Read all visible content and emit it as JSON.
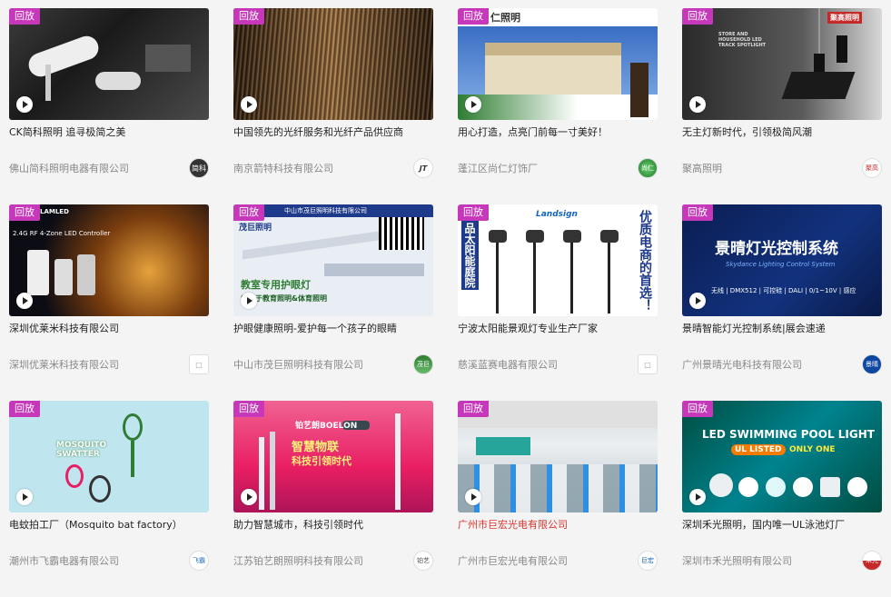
{
  "badge_label": "回放",
  "cards": [
    {
      "title": "CK简科照明 追寻极简之美",
      "company": "佛山简科照明电器有限公司",
      "title_color": "#222222"
    },
    {
      "title": "中国领先的光纤服务和光纤产品供应商",
      "company": "南京箭特科技有限公司",
      "title_color": "#222222"
    },
    {
      "title": "用心打造，点亮门前每一寸美好！",
      "company": "蓬江区尚仁灯饰厂",
      "title_color": "#222222"
    },
    {
      "title": "无主灯新时代，引领极简风潮",
      "company": "聚高照明",
      "title_color": "#222222"
    },
    {
      "title": "深圳优莱米科技有限公司",
      "company": "深圳优莱米科技有限公司",
      "title_color": "#222222"
    },
    {
      "title": "护眼健康照明-爱护每一个孩子的眼睛",
      "company": "中山市茂巨照明科技有限公司",
      "title_color": "#222222"
    },
    {
      "title": "宁波太阳能景观灯专业生产厂家",
      "company": "慈溪蓝赛电器有限公司",
      "title_color": "#222222"
    },
    {
      "title": "景晴智能灯光控制系统|展会速递",
      "company": "广州景晴光电科技有限公司",
      "title_color": "#222222"
    },
    {
      "title": "电蚊拍工厂（Mosquito bat factory）",
      "company": "潮州市飞霸电器有限公司",
      "title_color": "#222222"
    },
    {
      "title": "助力智慧城市，科技引领时代",
      "company": "江苏铂艺朗照明科技有限公司",
      "title_color": "#222222"
    },
    {
      "title": "广州市巨宏光电有限公司",
      "company": "广州市巨宏光电有限公司",
      "title_color": "#d9352b"
    },
    {
      "title": "深圳禾光照明，国内唯一UL泳池灯厂",
      "company": "深圳市禾光照明有限公司",
      "title_color": "#222222"
    }
  ],
  "thumb_text": {
    "c3_brand": "仁照明",
    "c4_top": "聚高照明",
    "c4_sub": "STORE AND HOUSEHOLD LED TRACK SPOTLIGHT",
    "c5_brand": "LAMLED",
    "c5_sub": "2.4G RF 4-Zone LED Controller",
    "c6_header": "中山市茂巨照明科技有限公司",
    "c6_brand": "茂巨照明",
    "c6_line1": "教室专用护眼灯",
    "c6_line2": "专注于教育照明&体育照明",
    "c7_brand": "Landsign",
    "c7_left": "品太阳能庭院",
    "c7_right": "优质电商的首选！",
    "c8_title": "景晴灯光控制系统",
    "c8_sub": "Skydance Lighting Control System",
    "c8_tags": "无线 | DMX512 | 可控硅 | DALI | 0/1~10V | 感应",
    "c9_title": "MOSQUITO SWATTER",
    "c10_brand": "铂艺朗BOELON",
    "c10_line1": "智慧物联",
    "c10_line2": "科技引领时代",
    "c12_title": "LED SWIMMING POOL LIGHT",
    "c12_ul": "UL LISTED",
    "c12_only": "ONLY ONE"
  },
  "logos": [
    "简科",
    "JT",
    "尚仁",
    "聚高",
    "□",
    "茂巨",
    "□",
    "景晴",
    "飞霸",
    "铂艺",
    "巨宏",
    "禾光"
  ],
  "colors": {
    "badge": "#c637b9",
    "highlight_title": "#d9352b"
  }
}
